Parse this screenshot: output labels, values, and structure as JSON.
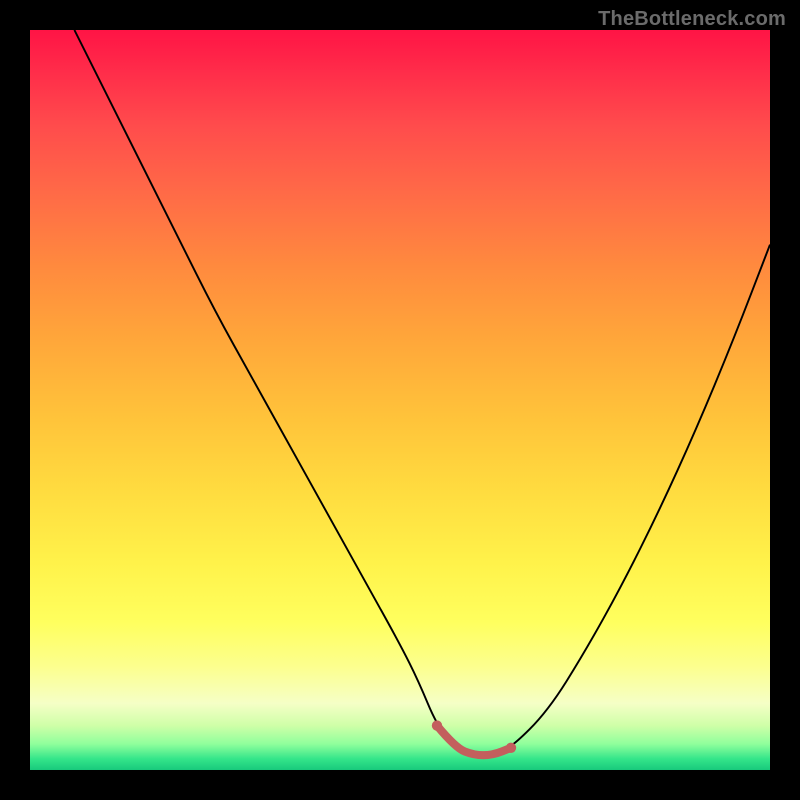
{
  "watermark": {
    "text": "TheBottleneck.com"
  },
  "chart_data": {
    "type": "line",
    "title": "",
    "xlabel": "",
    "ylabel": "",
    "xlim": [
      0,
      100
    ],
    "ylim": [
      0,
      100
    ],
    "series": [
      {
        "name": "bottleneck-curve",
        "x": [
          6,
          10,
          15,
          20,
          25,
          30,
          35,
          40,
          45,
          50,
          52.5,
          55,
          57.5,
          60,
          62.5,
          65,
          70,
          75,
          80,
          85,
          90,
          95,
          100
        ],
        "y": [
          100,
          92,
          82,
          72,
          62,
          53,
          44,
          35,
          26,
          17,
          12,
          6,
          3,
          2,
          2,
          3,
          8,
          16,
          25,
          35,
          46,
          58,
          71
        ]
      }
    ],
    "highlight_segment": {
      "name": "optimal-range",
      "x": [
        55,
        57.5,
        60,
        62.5,
        65
      ],
      "y": [
        6,
        3,
        2,
        2,
        3
      ]
    },
    "gradient_stops": [
      {
        "pos": 0,
        "color": "#ff1445"
      },
      {
        "pos": 0.5,
        "color": "#ffdb3f"
      },
      {
        "pos": 0.9,
        "color": "#f5ffc6"
      },
      {
        "pos": 1.0,
        "color": "#18c97c"
      }
    ]
  }
}
